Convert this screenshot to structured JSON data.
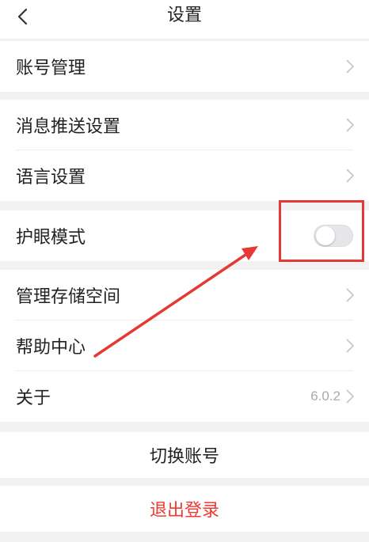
{
  "header": {
    "title": "设置",
    "back_icon": "chevron-left-icon"
  },
  "groups": {
    "account": {
      "label": "账号管理"
    },
    "push": {
      "label": "消息推送设置"
    },
    "language": {
      "label": "语言设置"
    },
    "eye_mode": {
      "label": "护眼模式",
      "enabled": false
    },
    "storage": {
      "label": "管理存储空间"
    },
    "help": {
      "label": "帮助中心"
    },
    "about": {
      "label": "关于",
      "version": "6.0.2"
    }
  },
  "actions": {
    "switch_account": "切换账号",
    "logout": "退出登录"
  },
  "colors": {
    "annotation": "#e53935",
    "logout_text": "#f03a2f",
    "background": "#f2f2f2"
  }
}
